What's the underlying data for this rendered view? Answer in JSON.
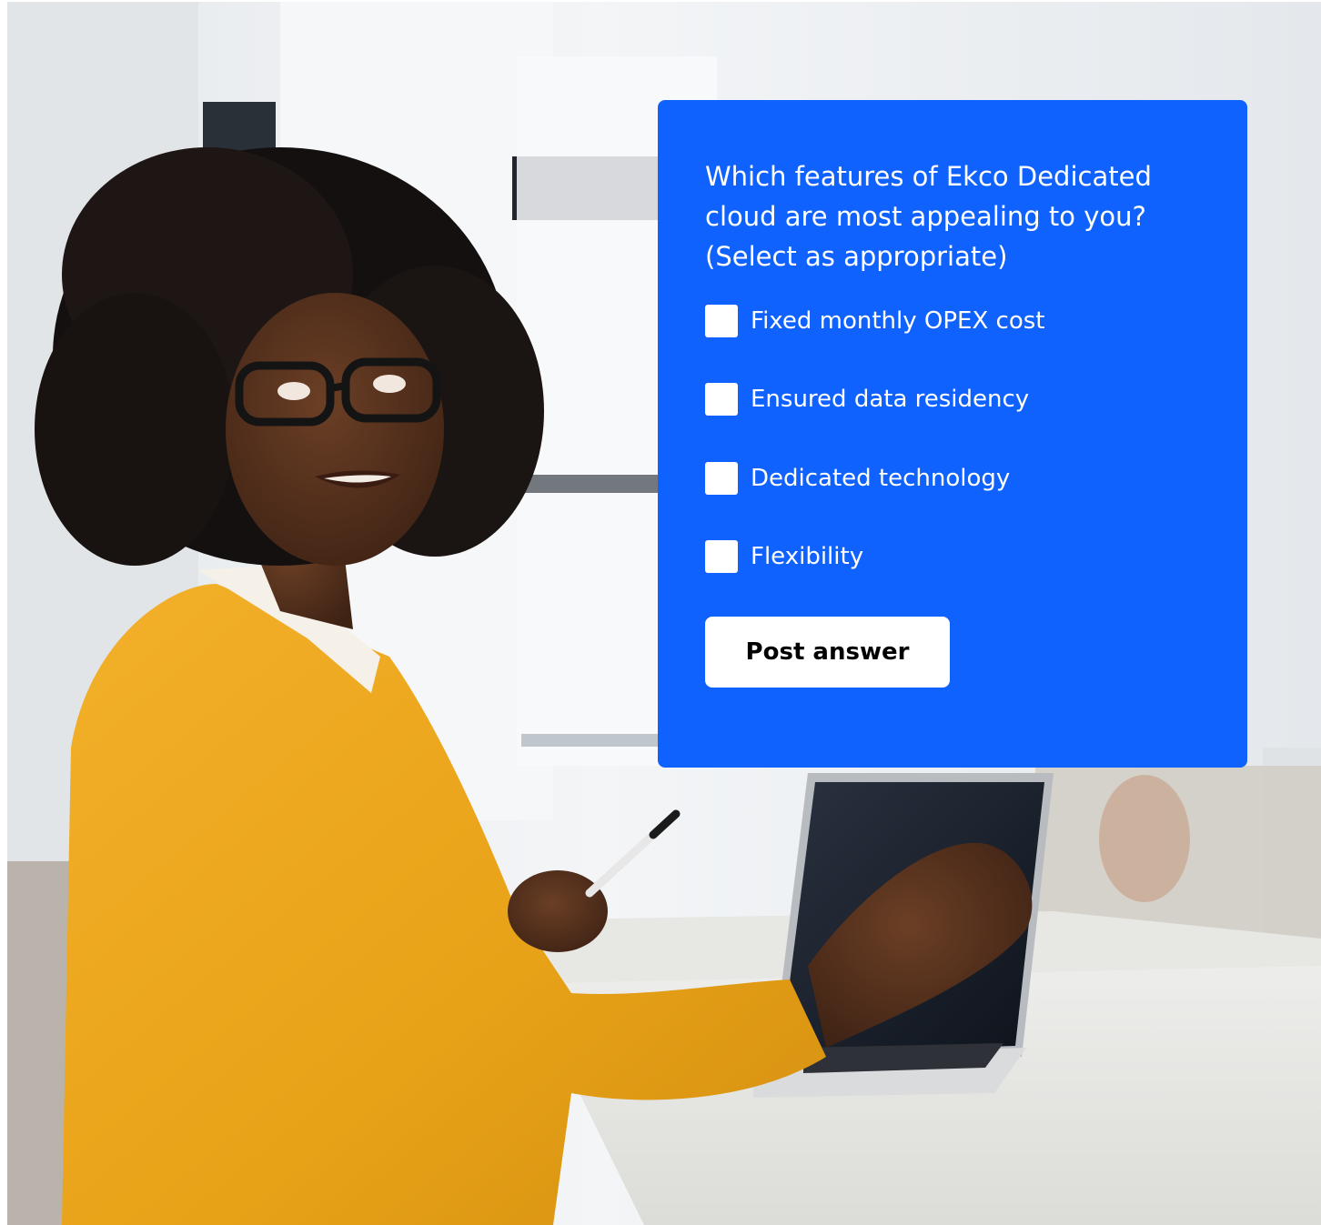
{
  "poll": {
    "question": "Which features of Ekco Dedicated cloud are most appealing to you? (Select as appropriate)",
    "options": [
      {
        "label": "Fixed monthly OPEX cost",
        "checked": false
      },
      {
        "label": "Ensured data residency",
        "checked": false
      },
      {
        "label": "Dedicated technology",
        "checked": false
      },
      {
        "label": "Flexibility",
        "checked": false
      }
    ],
    "submit_label": "Post answer",
    "accent_color": "#0f62fe"
  },
  "background": {
    "icon": "office-photo"
  }
}
